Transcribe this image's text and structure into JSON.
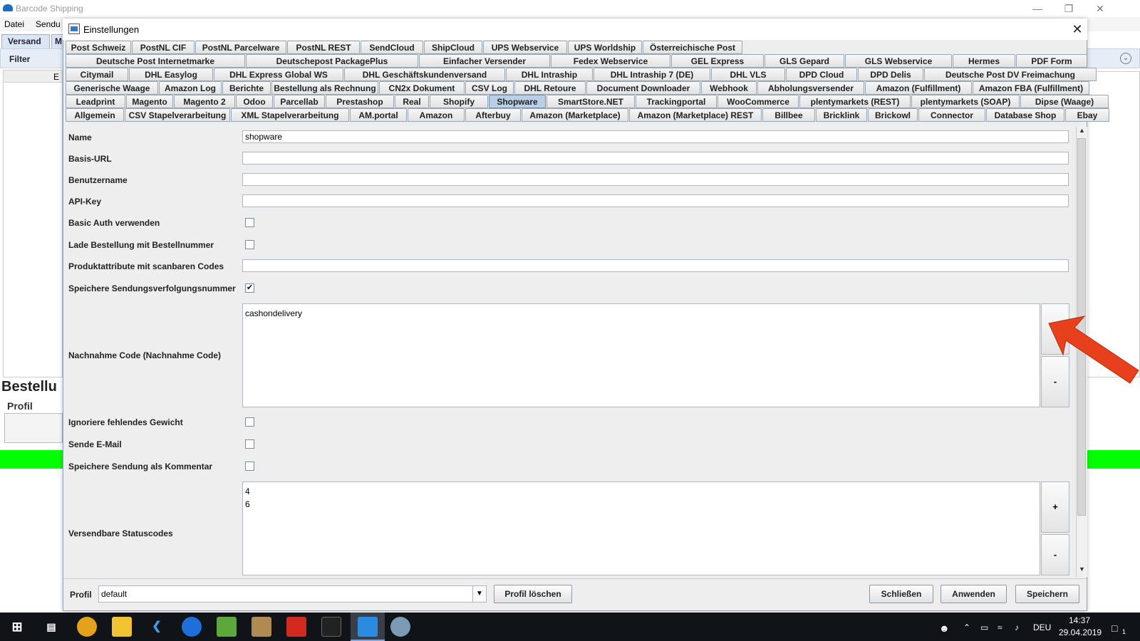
{
  "app": {
    "title": "Barcode Shipping",
    "menu": [
      "Datei",
      "Sendu"
    ],
    "tabs": [
      "Versand",
      "M"
    ],
    "filter_label": "Filter",
    "column_partial": "E",
    "section_title": "Bestellu",
    "profile_label": "Profil",
    "status_color": "#00ff00"
  },
  "dialog": {
    "title": "Einstellungen",
    "tabs": {
      "row1": [
        "Post Schweiz",
        "PostNL CIF",
        "PostNL Parcelware",
        "PostNL REST",
        "SendCloud",
        "ShipCloud",
        "UPS Webservice",
        "UPS Worldship",
        "Österreichische Post"
      ],
      "row2": [
        "Deutsche Post Internetmarke",
        "Deutschepost PackagePlus",
        "Einfacher Versender",
        "Fedex Webservice",
        "GEL Express",
        "GLS Gepard",
        "GLS Webservice",
        "Hermes",
        "PDF Form"
      ],
      "row3": [
        "Citymail",
        "DHL Easylog",
        "DHL Express Global WS",
        "DHL Geschäftskundenversand",
        "DHL Intraship",
        "DHL Intraship 7 (DE)",
        "DHL VLS",
        "DPD Cloud",
        "DPD Delis",
        "Deutsche Post DV Freimachung"
      ],
      "row4": [
        "Generische Waage",
        "Amazon Log",
        "Berichte",
        "Bestellung als Rechnung",
        "CN2x Dokument",
        "CSV Log",
        "DHL Retoure",
        "Document Downloader",
        "Webhook",
        "Abholungsversender",
        "Amazon (Fulfillment)",
        "Amazon FBA (Fulfillment)"
      ],
      "row5": [
        "Leadprint",
        "Magento",
        "Magento 2",
        "Odoo",
        "Parcellab",
        "Prestashop",
        "Real",
        "Shopify",
        "Shopware",
        "SmartStore.NET",
        "Trackingportal",
        "WooCommerce",
        "plentymarkets (REST)",
        "plentymarkets (SOAP)",
        "Dipse (Waage)"
      ],
      "row6": [
        "Allgemein",
        "CSV Stapelverarbeitung",
        "XML Stapelverarbeitung",
        "AM.portal",
        "Amazon",
        "Afterbuy",
        "Amazon (Marketplace)",
        "Amazon (Marketplace) REST",
        "Billbee",
        "Bricklink",
        "Brickowl",
        "Connector",
        "Database Shop",
        "Ebay"
      ],
      "selected": "Shopware"
    },
    "form": {
      "name_label": "Name",
      "name_value": "shopware",
      "baseurl_label": "Basis-URL",
      "baseurl_value": "",
      "username_label": "Benutzername",
      "username_value": "",
      "apikey_label": "API-Key",
      "apikey_value": "",
      "basicauth_label": "Basic Auth verwenden",
      "basicauth_checked": false,
      "loadorder_label": "Lade Bestellung mit Bestellnummer",
      "loadorder_checked": false,
      "productattr_label": "Produktattribute mit scanbaren Codes",
      "productattr_value": "",
      "savetracking_label": "Speichere Sendungsverfolgungsnummer",
      "savetracking_checked": true,
      "cod_label": "Nachnahme Code (Nachnahme Code)",
      "cod_values": [
        "cashondelivery"
      ],
      "ignoreweight_label": "Ignoriere fehlendes Gewicht",
      "ignoreweight_checked": false,
      "sendmail_label": "Sende E-Mail",
      "sendmail_checked": false,
      "savecomment_label": "Speichere Sendung als Kommentar",
      "savecomment_checked": false,
      "status_label": "Versendbare Statuscodes",
      "status_values": [
        "4",
        "6"
      ],
      "add_label": "+",
      "remove_label": "-"
    },
    "footer": {
      "profile_label": "Profil",
      "profile_value": "default",
      "delete_profile": "Profil löschen",
      "close": "Schließen",
      "apply": "Anwenden",
      "save": "Speichern"
    },
    "arrow_color": "#e8401c"
  },
  "taskbar": {
    "language": "DEU",
    "time": "14:37",
    "date": "29.04.2019",
    "notification_count": "1"
  }
}
